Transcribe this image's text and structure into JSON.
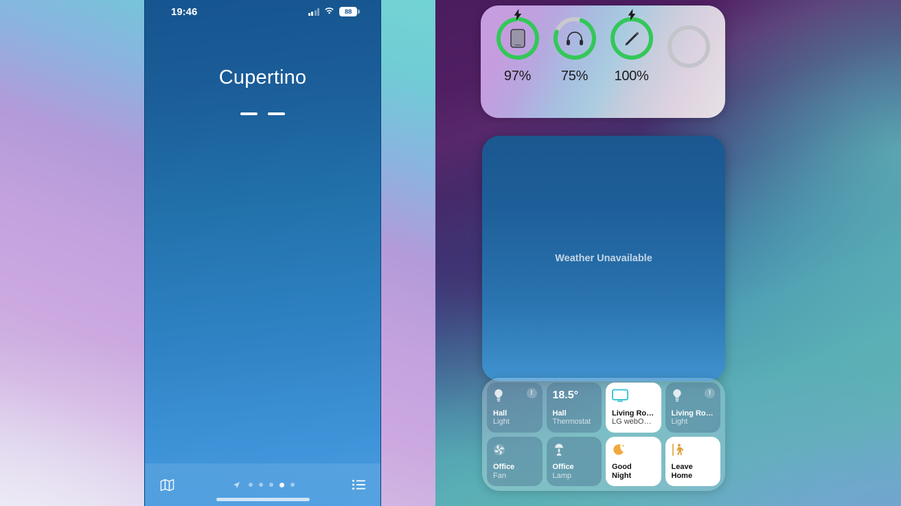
{
  "left_phone": {
    "status_bar": {
      "time": "19:46",
      "signal_icon": "cellular-signal-icon",
      "wifi_icon": "wifi-icon",
      "battery_percent": "88"
    },
    "weather": {
      "city": "Cupertino",
      "temperature": "— —",
      "dash_count": 2
    },
    "bottom_bar": {
      "map_icon": "map-icon",
      "list_icon": "list-icon",
      "location_arrow_icon": "location-arrow-icon",
      "page_dots_total": 5,
      "page_dots_active_index": 3
    }
  },
  "right_phone": {
    "battery_widget": {
      "items": [
        {
          "icon": "ipad-icon",
          "percent": "97%",
          "ring_value": 97,
          "charging": true,
          "color": "#34c759"
        },
        {
          "icon": "headphones-icon",
          "percent": "75%",
          "ring_value": 75,
          "charging": false,
          "color": "#34c759"
        },
        {
          "icon": "apple-pencil-icon",
          "percent": "100%",
          "ring_value": 100,
          "charging": true,
          "color": "#34c759"
        },
        {
          "icon": "empty-slot-icon",
          "percent": "",
          "ring_value": 0,
          "charging": false,
          "color": "#c7c7cc"
        }
      ]
    },
    "weather_widget": {
      "message": "Weather Unavailable"
    },
    "home_widget": {
      "tiles": [
        {
          "icon": "lightbulb-icon",
          "line1": "Hall",
          "line2": "Light",
          "state": "off",
          "badge": "!",
          "value": ""
        },
        {
          "icon": "thermostat-icon",
          "line1": "Hall",
          "line2": "Thermostat",
          "state": "off",
          "badge": "",
          "value": "18.5°"
        },
        {
          "icon": "tv-icon",
          "line1": "Living Ro…",
          "line2": "LG webO…",
          "state": "on",
          "badge": "",
          "value": ""
        },
        {
          "icon": "lightbulb-icon",
          "line1": "Living Ro…",
          "line2": "Light",
          "state": "off",
          "badge": "!",
          "value": ""
        },
        {
          "icon": "fan-icon",
          "line1": "Office",
          "line2": "Fan",
          "state": "off",
          "badge": "",
          "value": ""
        },
        {
          "icon": "lamp-icon",
          "line1": "Office",
          "line2": "Lamp",
          "state": "off",
          "badge": "",
          "value": ""
        },
        {
          "icon": "moon-stars-icon",
          "line1": "Good",
          "line2": "Night",
          "state": "on",
          "badge": "",
          "value": ""
        },
        {
          "icon": "walking-person-icon",
          "line1": "Leave",
          "line2": "Home",
          "state": "on",
          "badge": "",
          "value": ""
        }
      ]
    }
  },
  "colors": {
    "ring_green": "#34c759",
    "ring_gray": "#c7c7cc",
    "tv_icon": "#41c4d8",
    "moon_icon": "#f0a93c",
    "walking_icon": "#e0a13a",
    "left_phone_blue": "#2272ac"
  }
}
